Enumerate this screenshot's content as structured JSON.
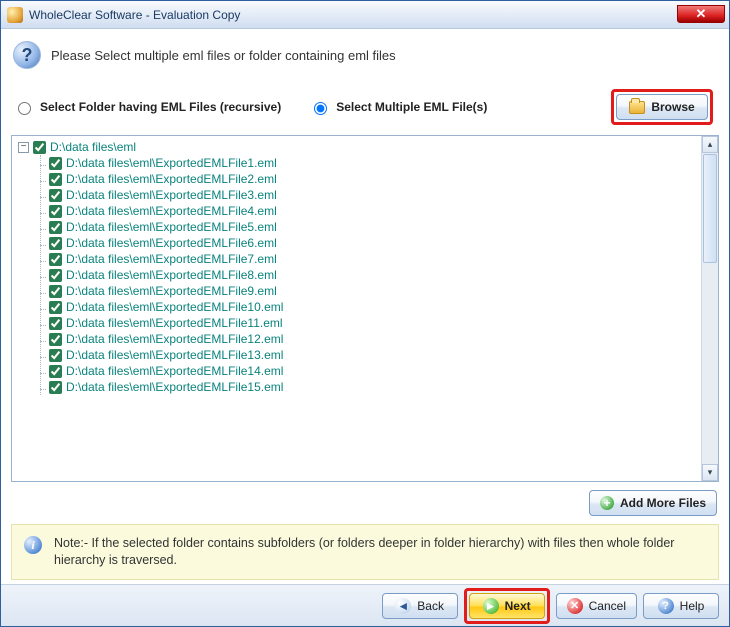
{
  "window": {
    "title": "WholeClear Software - Evaluation Copy"
  },
  "instruction": "Please Select multiple eml files or folder containing eml files",
  "radios": {
    "folder_label": "Select Folder having EML Files (recursive)",
    "multi_label": "Select Multiple EML File(s)"
  },
  "browse_label": "Browse",
  "add_more_label": "Add More Files",
  "tree": {
    "root_label": "D:\\data files\\eml",
    "files": [
      "D:\\data files\\eml\\ExportedEMLFile1.eml",
      "D:\\data files\\eml\\ExportedEMLFile2.eml",
      "D:\\data files\\eml\\ExportedEMLFile3.eml",
      "D:\\data files\\eml\\ExportedEMLFile4.eml",
      "D:\\data files\\eml\\ExportedEMLFile5.eml",
      "D:\\data files\\eml\\ExportedEMLFile6.eml",
      "D:\\data files\\eml\\ExportedEMLFile7.eml",
      "D:\\data files\\eml\\ExportedEMLFile8.eml",
      "D:\\data files\\eml\\ExportedEMLFile9.eml",
      "D:\\data files\\eml\\ExportedEMLFile10.eml",
      "D:\\data files\\eml\\ExportedEMLFile11.eml",
      "D:\\data files\\eml\\ExportedEMLFile12.eml",
      "D:\\data files\\eml\\ExportedEMLFile13.eml",
      "D:\\data files\\eml\\ExportedEMLFile14.eml",
      "D:\\data files\\eml\\ExportedEMLFile15.eml"
    ]
  },
  "note": "Note:- If the selected folder contains subfolders (or folders deeper in folder hierarchy) with files then whole folder hierarchy is traversed.",
  "footer": {
    "back": "Back",
    "next": "Next",
    "cancel": "Cancel",
    "help": "Help"
  }
}
